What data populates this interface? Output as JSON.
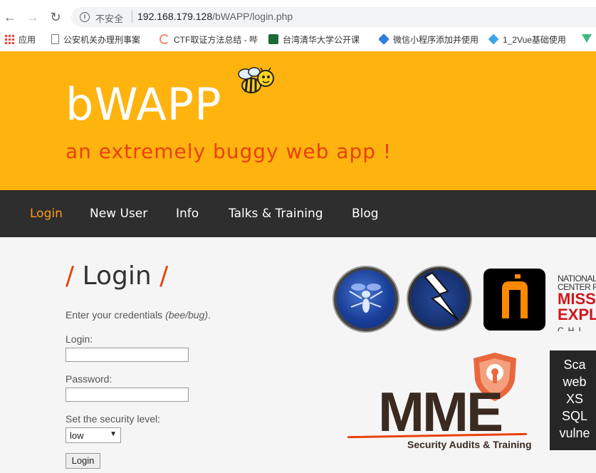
{
  "browser": {
    "back": "←",
    "forward": "→",
    "reload": "↻",
    "security_label": "不安全",
    "url_host": "192.168.179.128",
    "url_path": "/bWAPP/login.php"
  },
  "bookmarks": [
    {
      "label": "应用"
    },
    {
      "label": "公安机关办理刑事案"
    },
    {
      "label": "CTF取证方法总结 - 哔"
    },
    {
      "label": "台湾清华大学公开课"
    },
    {
      "label": "微信小程序添加并使用"
    },
    {
      "label": "1_2Vue基础使用"
    }
  ],
  "header": {
    "logo": "bWAPP",
    "tagline": "an extremely buggy web app !"
  },
  "menu": [
    {
      "label": "Login",
      "active": true
    },
    {
      "label": "New User"
    },
    {
      "label": "Info"
    },
    {
      "label": "Talks & Training"
    },
    {
      "label": "Blog"
    }
  ],
  "main": {
    "title_left": "/",
    "title": "Login",
    "title_right": "/",
    "credentials_text": "Enter your credentials ",
    "credentials_hint": "(bee/bug)",
    "credentials_end": ".",
    "login_label": "Login:",
    "password_label": "Password:",
    "security_label": "Set the security level:",
    "security_value": "low",
    "submit_label": "Login"
  },
  "sponsors": {
    "ncmec_line1": "NATIONAL",
    "ncmec_line2": "CENTER F",
    "ncmec_line3": "MISS",
    "ncmec_line4": "EXPL",
    "ncmec_line5": "CHI",
    "mme_logo": "MME",
    "mme_sub": "Security Audits & Training",
    "scan_lines": [
      "Sca",
      "web",
      "XS",
      "SQL",
      "vulne"
    ]
  },
  "colors": {
    "header_bg": "#ffb30f",
    "tagline": "#e8410b",
    "menu_bg": "#2e2e2e",
    "menu_active": "#ff9a1f"
  }
}
